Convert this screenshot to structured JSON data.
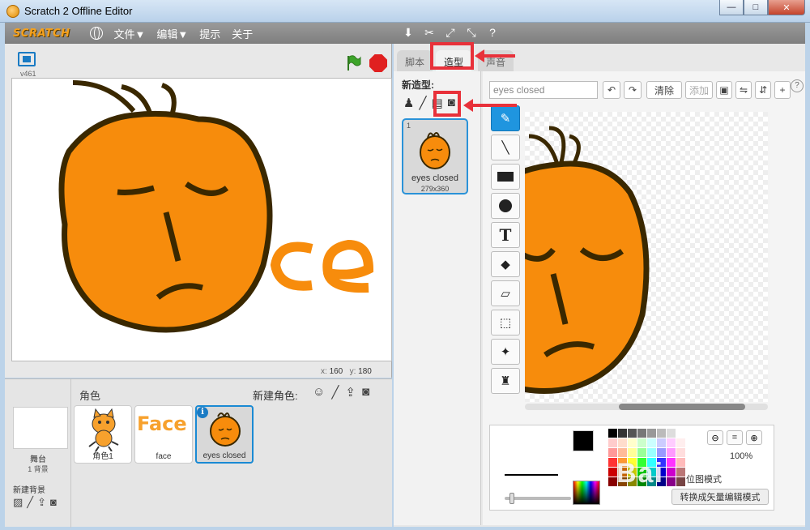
{
  "window": {
    "title": "Scratch 2 Offline Editor"
  },
  "menu": {
    "logo": "SCRATCH",
    "file": "文件▼",
    "edit": "编辑▼",
    "tips": "提示",
    "about": "关于"
  },
  "stage": {
    "version": "v461",
    "coord_x_label": "x:",
    "coord_x": "160",
    "coord_y_label": "y:",
    "coord_y": "180"
  },
  "sprites": {
    "header": "角色",
    "new_sprite_label": "新建角色:",
    "stage_label": "舞台",
    "backdrop_count": "1 背景",
    "new_backdrop_label": "新建背景",
    "items": [
      {
        "name": "角色1"
      },
      {
        "name": "face",
        "art": "Face"
      },
      {
        "name": "eyes closed"
      }
    ]
  },
  "tabs": {
    "scripts": "脚本",
    "costumes": "造型",
    "sounds": "声音"
  },
  "costumes": {
    "new_costume_label": "新造型:",
    "items": [
      {
        "index": "1",
        "name": "eyes closed",
        "size": "279x360"
      }
    ]
  },
  "editor": {
    "costume_name": "eyes closed",
    "clear_label": "清除",
    "add_label": "添加",
    "zoom": "100%",
    "mode_label": "位图模式",
    "convert_label": "转换成矢量编辑模式"
  },
  "watermark": "Bai",
  "colors": {
    "orange": "#f78c0c",
    "outline": "#3a2800",
    "accent": "#1f95df",
    "highlight": "#e8313a"
  }
}
